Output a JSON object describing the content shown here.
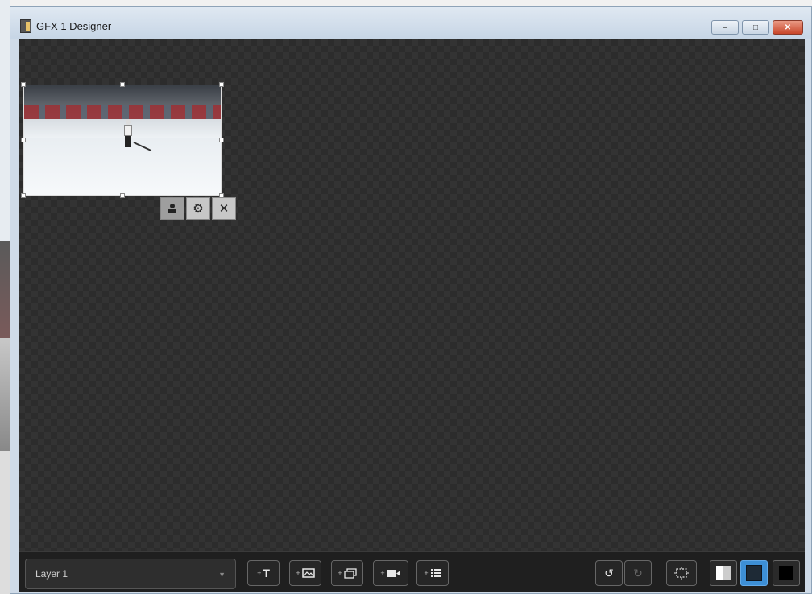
{
  "window": {
    "title": "GFX 1 Designer",
    "controls": {
      "minimize": "–",
      "maximize": "□",
      "close": "✕"
    }
  },
  "canvas": {
    "layer": {
      "type": "video-input",
      "content": "hockey-rink-camera-feed",
      "selected": true
    },
    "object_toolbar": [
      {
        "name": "video-source",
        "icon": "user-icon"
      },
      {
        "name": "settings",
        "icon": "gear-icon"
      },
      {
        "name": "delete",
        "icon": "close-icon"
      }
    ]
  },
  "bottom_bar": {
    "layer_select": {
      "value": "Layer 1"
    },
    "add_buttons": [
      {
        "name": "add-text",
        "icon": "text-icon",
        "glyph": "T"
      },
      {
        "name": "add-image",
        "icon": "image-icon"
      },
      {
        "name": "add-slideshow",
        "icon": "slideshow-icon"
      },
      {
        "name": "add-video",
        "icon": "video-camera-icon"
      },
      {
        "name": "add-list",
        "icon": "list-icon"
      }
    ],
    "undo": {
      "icon": "undo-icon",
      "glyph": "↺"
    },
    "redo": {
      "icon": "redo-icon",
      "glyph": "↻",
      "enabled": false
    },
    "fit": {
      "icon": "fit-screen-icon"
    },
    "backgrounds": [
      {
        "name": "checkerboard",
        "selected": false
      },
      {
        "name": "dark",
        "selected": true,
        "accent": "#3d8fd6"
      },
      {
        "name": "black",
        "selected": false
      }
    ]
  }
}
